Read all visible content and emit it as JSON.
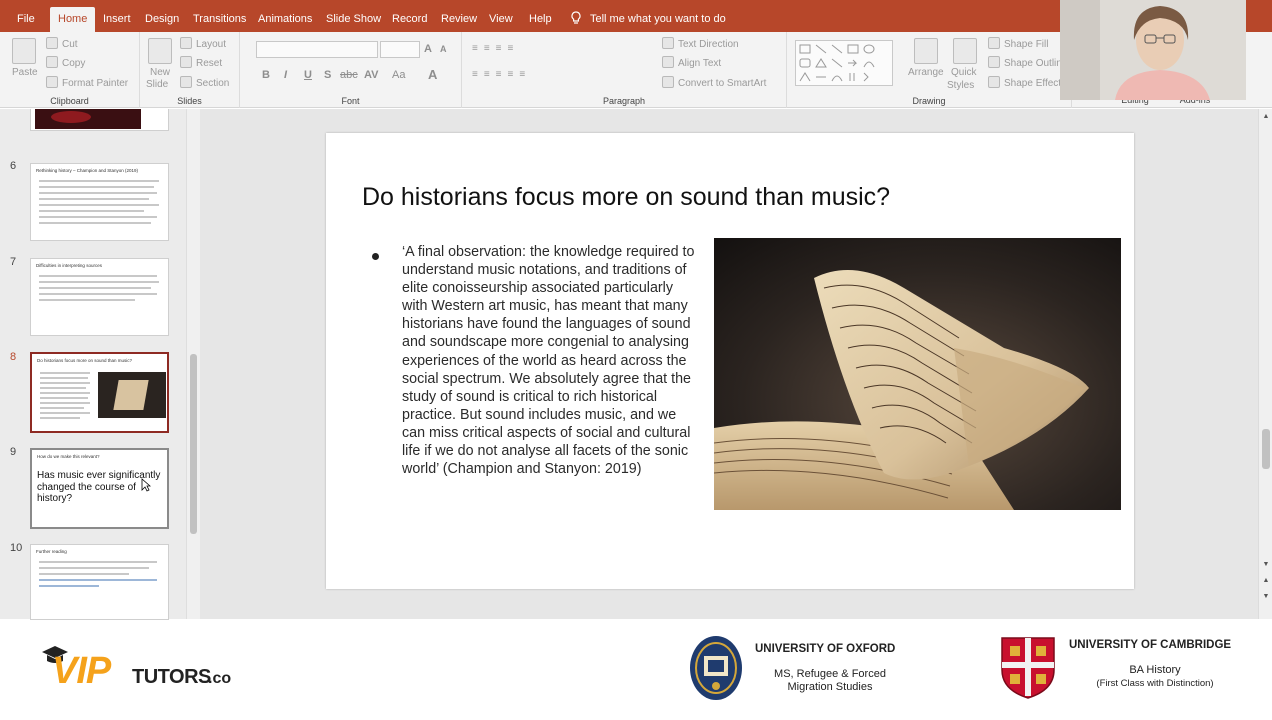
{
  "tabs": {
    "file": "File",
    "home": "Home",
    "insert": "Insert",
    "design": "Design",
    "transitions": "Transitions",
    "animations": "Animations",
    "slideshow": "Slide Show",
    "record": "Record",
    "review": "Review",
    "view": "View",
    "help": "Help",
    "tell_me": "Tell me what you want to do"
  },
  "ribbon": {
    "clipboard": {
      "label": "Clipboard",
      "paste": "Paste",
      "cut": "Cut",
      "copy": "Copy",
      "format_painter": "Format Painter"
    },
    "slides": {
      "label": "Slides",
      "new_slide": "New",
      "new_slide2": "Slide",
      "layout": "Layout",
      "reset": "Reset",
      "section": "Section"
    },
    "font": {
      "label": "Font",
      "bold": "B",
      "italic": "I",
      "underline": "U",
      "shadow": "S",
      "strike": "abc",
      "spacing": "AV",
      "case": "Aa",
      "grow": "A",
      "shrink": "A"
    },
    "paragraph": {
      "label": "Paragraph",
      "text_direction": "Text Direction",
      "align_text": "Align Text",
      "convert_smartart": "Convert to SmartArt"
    },
    "drawing": {
      "label": "Drawing",
      "arrange": "Arrange",
      "quick_styles": "Quick",
      "quick_styles2": "Styles",
      "shape_fill": "Shape Fill",
      "shape_outline": "Shape Outline",
      "shape_effects": "Shape Effects"
    },
    "editing": {
      "label": "Editing"
    },
    "addins": {
      "label": "Add-ins"
    }
  },
  "slide_panel": {
    "slides": [
      {
        "num": "6",
        "title": "Rethinking history – Champion and Stanyon (2019)"
      },
      {
        "num": "7",
        "title": "Difficulties in interpreting sources"
      },
      {
        "num": "8",
        "title": "Do historians focus more on sound than music?"
      },
      {
        "num": "9",
        "title": "How do we make this relevant?",
        "body": "Has music ever significantly changed the course of history?"
      },
      {
        "num": "10",
        "title": "Further reading"
      }
    ]
  },
  "slide": {
    "title": "Do historians focus more on sound than music?",
    "quote": "‘A final observation: the knowledge required to understand music notations, and traditions of elite conoisseurship associated particularly with Western art music, has meant that many historians have found the languages of sound and soundscape more congenial to analysing experiences of the world as heard across the social spectrum. We absolutely agree that the study of sound is critical to rich historical practice. But sound includes music, and we can miss critical aspects of social and cultural life if we do not analyse all facets of the sonic world’ (Champion and Stanyon: 2019)"
  },
  "footer": {
    "logo_vip": "VIP",
    "logo_tutors": "TUTORS",
    "logo_co": ".co",
    "oxford_name": "UNIVERSITY OF OXFORD",
    "oxford_line1": "MS, Refugee & Forced",
    "oxford_line2": "Migration Studies",
    "cambridge_name": "UNIVERSITY OF CAMBRIDGE",
    "cambridge_line1": "BA History",
    "cambridge_line2": "(First Class with Distinction)"
  },
  "colors": {
    "accent": "#b7472a",
    "selected_slide_border": "#8e2a23",
    "logo_orange": "#f5a21b",
    "cambridge_red": "#c8102e"
  }
}
